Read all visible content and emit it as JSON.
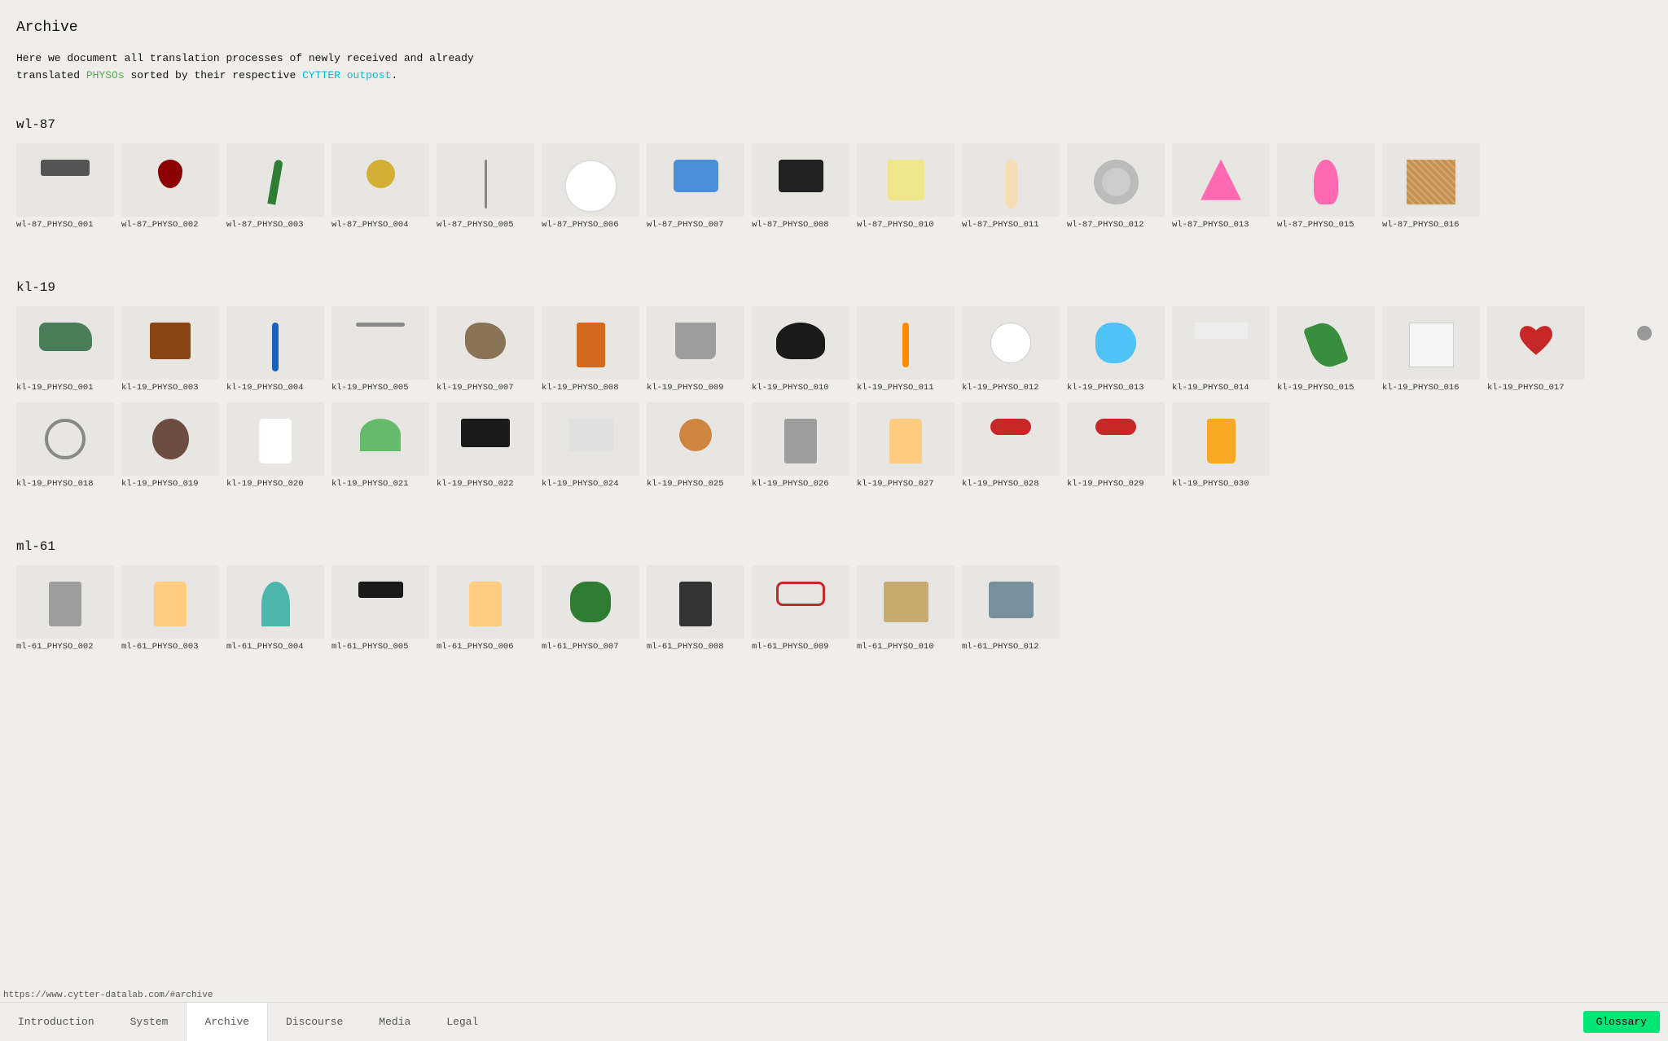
{
  "page": {
    "title": "Archive",
    "intro_line1": "Here we document all translation processes of newly received and already",
    "intro_line2": "translated",
    "intro_physos": "PHYSOs",
    "intro_line3": "sorted by their respective",
    "intro_cytter": "CYTTER outpost",
    "intro_end": ".",
    "status_url": "https://www.cytter-datalab.com/#archive"
  },
  "sections": [
    {
      "id": "wl-87",
      "title": "wl-87",
      "items": [
        {
          "id": "wl-87_PHYSO_001",
          "shape": "harmonica"
        },
        {
          "id": "wl-87_PHYSO_002",
          "shape": "cherries"
        },
        {
          "id": "wl-87_PHYSO_003",
          "shape": "feather"
        },
        {
          "id": "wl-87_PHYSO_004",
          "shape": "brooch"
        },
        {
          "id": "wl-87_PHYSO_005",
          "shape": "needle"
        },
        {
          "id": "wl-87_PHYSO_006",
          "shape": "plate"
        },
        {
          "id": "wl-87_PHYSO_007",
          "shape": "purse"
        },
        {
          "id": "wl-87_PHYSO_008",
          "shape": "camera"
        },
        {
          "id": "wl-87_PHYSO_010",
          "shape": "sponge"
        },
        {
          "id": "wl-87_PHYSO_011",
          "shape": "bone"
        },
        {
          "id": "wl-87_PHYSO_012",
          "shape": "tape"
        },
        {
          "id": "wl-87_PHYSO_013",
          "shape": "origami"
        },
        {
          "id": "wl-87_PHYSO_015",
          "shape": "flamingo"
        },
        {
          "id": "wl-87_PHYSO_016",
          "shape": "texture"
        }
      ]
    },
    {
      "id": "kl-19",
      "title": "kl-19",
      "items": [
        {
          "id": "kl-19_PHYSO_001",
          "shape": "crocodile"
        },
        {
          "id": "kl-19_PHYSO_003",
          "shape": "bricks"
        },
        {
          "id": "kl-19_PHYSO_004",
          "shape": "pen"
        },
        {
          "id": "kl-19_PHYSO_005",
          "shape": "wire"
        },
        {
          "id": "kl-19_PHYSO_007",
          "shape": "lump"
        },
        {
          "id": "kl-19_PHYSO_008",
          "shape": "bag"
        },
        {
          "id": "kl-19_PHYSO_009",
          "shape": "bucket"
        },
        {
          "id": "kl-19_PHYSO_010",
          "shape": "helmet"
        },
        {
          "id": "kl-19_PHYSO_011",
          "shape": "brush"
        },
        {
          "id": "kl-19_PHYSO_012",
          "shape": "circle-white"
        },
        {
          "id": "kl-19_PHYSO_013",
          "shape": "elephant"
        },
        {
          "id": "kl-19_PHYSO_014",
          "shape": "white-flat"
        },
        {
          "id": "kl-19_PHYSO_015",
          "shape": "leaf"
        },
        {
          "id": "kl-19_PHYSO_016",
          "shape": "square"
        },
        {
          "id": "kl-19_PHYSO_017",
          "shape": "heart"
        },
        {
          "id": "kl-19_PHYSO_018",
          "shape": "magnifier"
        },
        {
          "id": "kl-19_PHYSO_019",
          "shape": "coconut"
        },
        {
          "id": "kl-19_PHYSO_020",
          "shape": "clown"
        },
        {
          "id": "kl-19_PHYSO_021",
          "shape": "umbrella"
        },
        {
          "id": "kl-19_PHYSO_022",
          "shape": "cables"
        },
        {
          "id": "kl-19_PHYSO_024",
          "shape": "envelope"
        },
        {
          "id": "kl-19_PHYSO_025",
          "shape": "coin"
        },
        {
          "id": "kl-19_PHYSO_026",
          "shape": "scissors"
        },
        {
          "id": "kl-19_PHYSO_027",
          "shape": "hand"
        },
        {
          "id": "kl-19_PHYSO_028",
          "shape": "bracelet"
        },
        {
          "id": "kl-19_PHYSO_029",
          "shape": "bracelet"
        },
        {
          "id": "kl-19_PHYSO_030",
          "shape": "jar"
        }
      ]
    },
    {
      "id": "ml-61",
      "title": "ml-61",
      "items": [
        {
          "id": "ml-61_PHYSO_002",
          "shape": "scissors"
        },
        {
          "id": "ml-61_PHYSO_003",
          "shape": "hand"
        },
        {
          "id": "ml-61_PHYSO_004",
          "shape": "hook"
        },
        {
          "id": "ml-61_PHYSO_005",
          "shape": "strap"
        },
        {
          "id": "ml-61_PHYSO_006",
          "shape": "hand"
        },
        {
          "id": "ml-61_PHYSO_007",
          "shape": "plants"
        },
        {
          "id": "ml-61_PHYSO_008",
          "shape": "tools"
        },
        {
          "id": "ml-61_PHYSO_009",
          "shape": "glasses"
        },
        {
          "id": "ml-61_PHYSO_010",
          "shape": "cardboard"
        },
        {
          "id": "ml-61_PHYSO_012",
          "shape": "keys"
        }
      ]
    }
  ],
  "nav": {
    "items": [
      {
        "id": "introduction",
        "label": "Introduction",
        "active": false
      },
      {
        "id": "system",
        "label": "System",
        "active": false
      },
      {
        "id": "archive",
        "label": "Archive",
        "active": true
      },
      {
        "id": "discourse",
        "label": "Discourse",
        "active": false
      },
      {
        "id": "media",
        "label": "Media",
        "active": false
      },
      {
        "id": "legal",
        "label": "Legal",
        "active": false
      }
    ],
    "glossary_label": "Glossary"
  }
}
